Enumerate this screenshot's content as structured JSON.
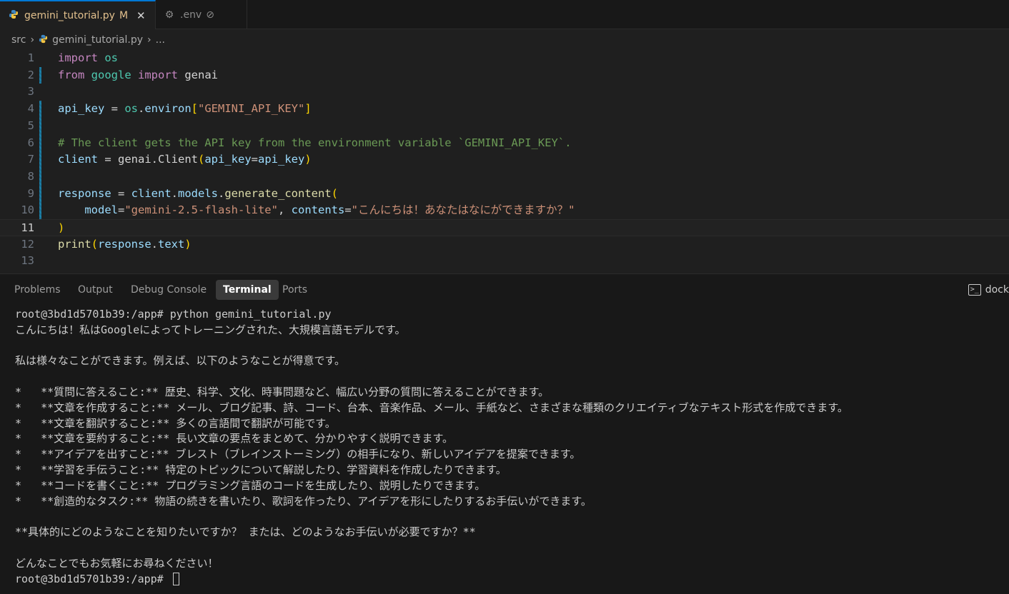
{
  "tabs": [
    {
      "name": "gemini_tutorial.py",
      "badge": "M",
      "close": "✕",
      "icon": "python-icon"
    },
    {
      "name": ".env",
      "badge": "⊘",
      "icon": "gear-icon"
    }
  ],
  "breadcrumb": {
    "folder": "src",
    "file": "gemini_tutorial.py",
    "more": "..."
  },
  "editor": {
    "current_line": 11,
    "line_numbers": [
      "1",
      "2",
      "3",
      "4",
      "5",
      "6",
      "7",
      "8",
      "9",
      "10",
      "11",
      "12",
      "13"
    ],
    "lines": [
      [
        {
          "t": "import",
          "c": "kw"
        },
        {
          "t": " ",
          "c": "pl"
        },
        {
          "t": "os",
          "c": "mod"
        }
      ],
      [
        {
          "t": "from",
          "c": "kw"
        },
        {
          "t": " ",
          "c": "pl"
        },
        {
          "t": "google",
          "c": "mod"
        },
        {
          "t": " ",
          "c": "pl"
        },
        {
          "t": "import",
          "c": "kw"
        },
        {
          "t": " genai",
          "c": "pl"
        }
      ],
      [],
      [
        {
          "t": "api_key",
          "c": "var"
        },
        {
          "t": " = ",
          "c": "pl"
        },
        {
          "t": "os",
          "c": "mod"
        },
        {
          "t": ".",
          "c": "pl"
        },
        {
          "t": "environ",
          "c": "var"
        },
        {
          "t": "[",
          "c": "br"
        },
        {
          "t": "\"GEMINI_API_KEY\"",
          "c": "str"
        },
        {
          "t": "]",
          "c": "br"
        }
      ],
      [],
      [
        {
          "t": "# The client gets the API key from the environment variable `GEMINI_API_KEY`.",
          "c": "cm"
        }
      ],
      [
        {
          "t": "client",
          "c": "var"
        },
        {
          "t": " = genai.",
          "c": "pl"
        },
        {
          "t": "Client",
          "c": "pl"
        },
        {
          "t": "(",
          "c": "br"
        },
        {
          "t": "api_key",
          "c": "var"
        },
        {
          "t": "=",
          "c": "pl"
        },
        {
          "t": "api_key",
          "c": "var"
        },
        {
          "t": ")",
          "c": "br"
        }
      ],
      [],
      [
        {
          "t": "response",
          "c": "var"
        },
        {
          "t": " = ",
          "c": "pl"
        },
        {
          "t": "client",
          "c": "var"
        },
        {
          "t": ".",
          "c": "pl"
        },
        {
          "t": "models",
          "c": "var"
        },
        {
          "t": ".",
          "c": "pl"
        },
        {
          "t": "generate_content",
          "c": "fn"
        },
        {
          "t": "(",
          "c": "br"
        }
      ],
      [
        {
          "t": "    ",
          "c": "pl"
        },
        {
          "t": "model",
          "c": "var"
        },
        {
          "t": "=",
          "c": "pl"
        },
        {
          "t": "\"gemini-2.5-flash-lite\"",
          "c": "str"
        },
        {
          "t": ", ",
          "c": "pl"
        },
        {
          "t": "contents",
          "c": "var"
        },
        {
          "t": "=",
          "c": "pl"
        },
        {
          "t": "\"こんにちは！あなたはなにができますか？\"",
          "c": "str"
        }
      ],
      [
        {
          "t": ")",
          "c": "br"
        }
      ],
      [
        {
          "t": "print",
          "c": "fn"
        },
        {
          "t": "(",
          "c": "br"
        },
        {
          "t": "response",
          "c": "var"
        },
        {
          "t": ".",
          "c": "pl"
        },
        {
          "t": "text",
          "c": "var"
        },
        {
          "t": ")",
          "c": "br"
        }
      ],
      []
    ]
  },
  "panel": {
    "tabs": [
      "Problems",
      "Output",
      "Debug Console",
      "Terminal",
      "Ports"
    ],
    "active_tab": "Terminal",
    "terminal_name": "dock",
    "terminal_lines": [
      "root@3bd1d5701b39:/app# python gemini_tutorial.py",
      "こんにちは！私はGoogleによってトレーニングされた、大規模言語モデルです。",
      "",
      "私は様々なことができます。例えば、以下のようなことが得意です。",
      "",
      "*   **質問に答えること:** 歴史、科学、文化、時事問題など、幅広い分野の質問に答えることができます。",
      "*   **文章を作成すること:** メール、ブログ記事、詩、コード、台本、音楽作品、メール、手紙など、さまざまな種類のクリエイティブなテキスト形式を作成できます。",
      "*   **文章を翻訳すること:** 多くの言語間で翻訳が可能です。",
      "*   **文章を要約すること:** 長い文章の要点をまとめて、分かりやすく説明できます。",
      "*   **アイデアを出すこと:** ブレスト（ブレインストーミング）の相手になり、新しいアイデアを提案できます。",
      "*   **学習を手伝うこと:** 特定のトピックについて解説したり、学習資料を作成したりできます。",
      "*   **コードを書くこと:** プログラミング言語のコードを生成したり、説明したりできます。",
      "*   **創造的なタスク:** 物語の続きを書いたり、歌詞を作ったり、アイデアを形にしたりするお手伝いができます。",
      "",
      "**具体的にどのようなことを知りたいですか？ または、どのようなお手伝いが必要ですか？**",
      "",
      "どんなことでもお気軽にお尋ねください！",
      "root@3bd1d5701b39:/app# "
    ]
  }
}
